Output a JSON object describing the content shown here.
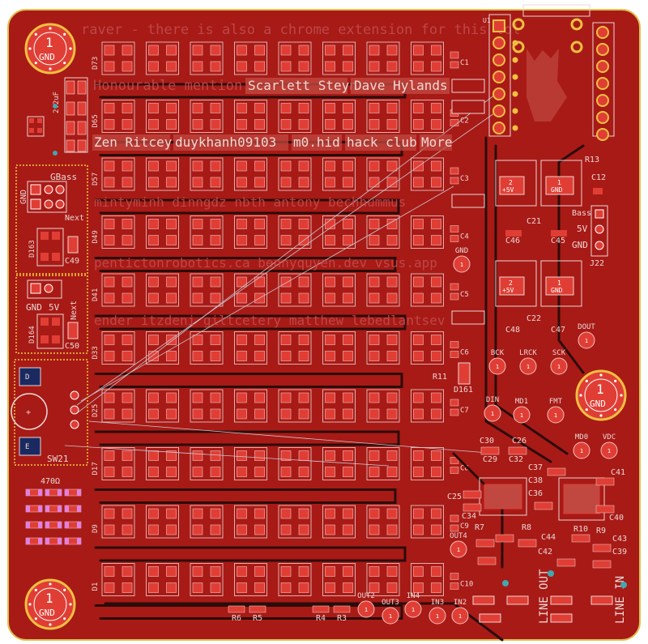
{
  "colors": {
    "board": "#a81a16",
    "board_edge": "#e0c050",
    "trace": "#2b0c0a",
    "silk": "#e8d7d4",
    "pad": "#e03e35",
    "via": "#40a8b0",
    "hole": "#ffffff",
    "ratsnest": "#c8c8d0",
    "ratsnest_pink": "#e080e0"
  },
  "silkscreen": {
    "line1": "raver - there is also a chrome extension for this lol",
    "honourable_mention": "Honourable mention:",
    "name_scarlett": "Scarlett Steyn",
    "name_dave": "Dave Hylands",
    "thanks_row3": [
      "Zen Ritcey",
      "duykhanh09103",
      "m0.hid",
      "hack club",
      "More"
    ],
    "thanks_row4": "mintyminh  dinngdz  nbth  antony  bechhummus",
    "thanks_row5": "pentictonrobotics.ca  bennyquyen.dev  vsus.app",
    "thanks_row6": "ender  itzdeni  giltcetery  matthew lebedlantsev"
  },
  "labels": {
    "gnd": "GND",
    "five_v": "5V",
    "next": "Next",
    "gbass": "GBass",
    "bass": "Bass",
    "c_2_2uf": "2.2uF",
    "r_470": "470Ω",
    "sw21": "SW21",
    "line_out": "LINE OUT",
    "line_in": "LINE IN",
    "plus5v": "+5V",
    "one": "1",
    "two": "2",
    "u1": "U1",
    "j22": "J22",
    "r13": "R13",
    "c12": "C12",
    "c21": "C21",
    "c22": "C22",
    "c45": "C45",
    "c46": "C46",
    "c47": "C47",
    "c48": "C48",
    "c49": "C49",
    "c50": "C50",
    "d161": "D161",
    "d163": "D163",
    "d164": "D164",
    "r11": "R11",
    "r6": "R6",
    "r5": "R5",
    "r4": "R4",
    "r3": "R3",
    "r7": "R7",
    "r8": "R8",
    "r9": "R9",
    "r10": "R10",
    "c26": "C26",
    "c29": "C29",
    "c30": "C30",
    "c32": "C32",
    "c34": "C34",
    "c25": "C25",
    "c36": "C36",
    "c37": "C37",
    "c38": "C38",
    "c40": "C40",
    "c41": "C41",
    "c39": "C39",
    "c42": "C42",
    "c43": "C43",
    "c44": "C44",
    "tp_bck": "BCK",
    "tp_lrck": "LRCK",
    "tp_sck": "SCK",
    "tp_dout": "DOUT",
    "tp_din": "DIN",
    "tp_md1": "MD1",
    "tp_fmt": "FMT",
    "tp_md0": "MD0",
    "tp_vdc": "VDC",
    "tp_out4": "OUT4",
    "tp_out2": "OUT2",
    "tp_out3": "OUT3",
    "tp_in3": "IN3",
    "tp_in2": "IN2",
    "tp_in4": "IN4",
    "tp_gnd": "GND"
  },
  "led_matrix": {
    "rows": 10,
    "cols": 8,
    "row_labels": [
      "D73",
      "D65",
      "D57",
      "D49",
      "D41",
      "D33",
      "D25",
      "D17",
      "D9",
      "D1"
    ],
    "right_labels": [
      "C1",
      "C2",
      "C3",
      "C4",
      "C5",
      "C6",
      "C7",
      "C8",
      "C9",
      "C10"
    ]
  },
  "mounting_holes": 4,
  "drawing_note": ""
}
